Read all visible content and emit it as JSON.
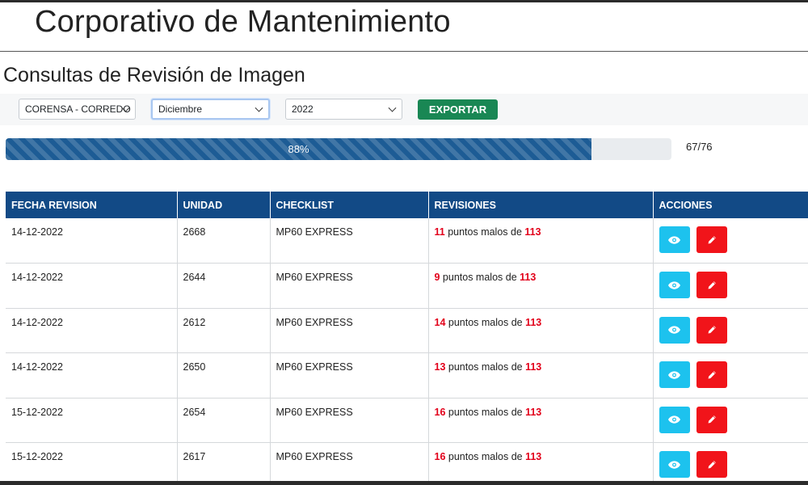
{
  "header": {
    "app_title": "Corporativo de Mantenimiento",
    "page_title": "Consultas de Revisión de Imagen"
  },
  "filters": {
    "cliente": "CORENSA - CORREDO",
    "mes": "Diciembre",
    "anio": "2022",
    "export_label": "EXPORTAR"
  },
  "progress": {
    "percent": 88,
    "label": "88%",
    "count": "67/76"
  },
  "table": {
    "columns": [
      "FECHA REVISION",
      "UNIDAD",
      "CHECKLIST",
      "REVISIONES",
      "ACCIONES"
    ],
    "rows": [
      {
        "fecha": "14-12-2022",
        "unidad": "2668",
        "checklist": "MP60 EXPRESS",
        "malos": "11",
        "texto": " puntos malos de ",
        "total": "113"
      },
      {
        "fecha": "14-12-2022",
        "unidad": "2644",
        "checklist": "MP60 EXPRESS",
        "malos": "9",
        "texto": " puntos malos de ",
        "total": "113"
      },
      {
        "fecha": "14-12-2022",
        "unidad": "2612",
        "checklist": "MP60 EXPRESS",
        "malos": "14",
        "texto": " puntos malos de ",
        "total": "113"
      },
      {
        "fecha": "14-12-2022",
        "unidad": "2650",
        "checklist": "MP60 EXPRESS",
        "malos": "13",
        "texto": " puntos malos de ",
        "total": "113"
      },
      {
        "fecha": "15-12-2022",
        "unidad": "2654",
        "checklist": "MP60 EXPRESS",
        "malos": "16",
        "texto": " puntos malos de ",
        "total": "113"
      },
      {
        "fecha": "15-12-2022",
        "unidad": "2617",
        "checklist": "MP60 EXPRESS",
        "malos": "16",
        "texto": " puntos malos de ",
        "total": "113"
      }
    ],
    "action_icons": [
      "eye-icon",
      "pencil-icon"
    ]
  },
  "colors": {
    "header_blue": "#124a86",
    "progress_blue": "#1d5c95",
    "export_green": "#198754",
    "view_cyan": "#1dc2ee",
    "edit_red": "#f1141a",
    "bad_points_red": "#e2001a"
  }
}
